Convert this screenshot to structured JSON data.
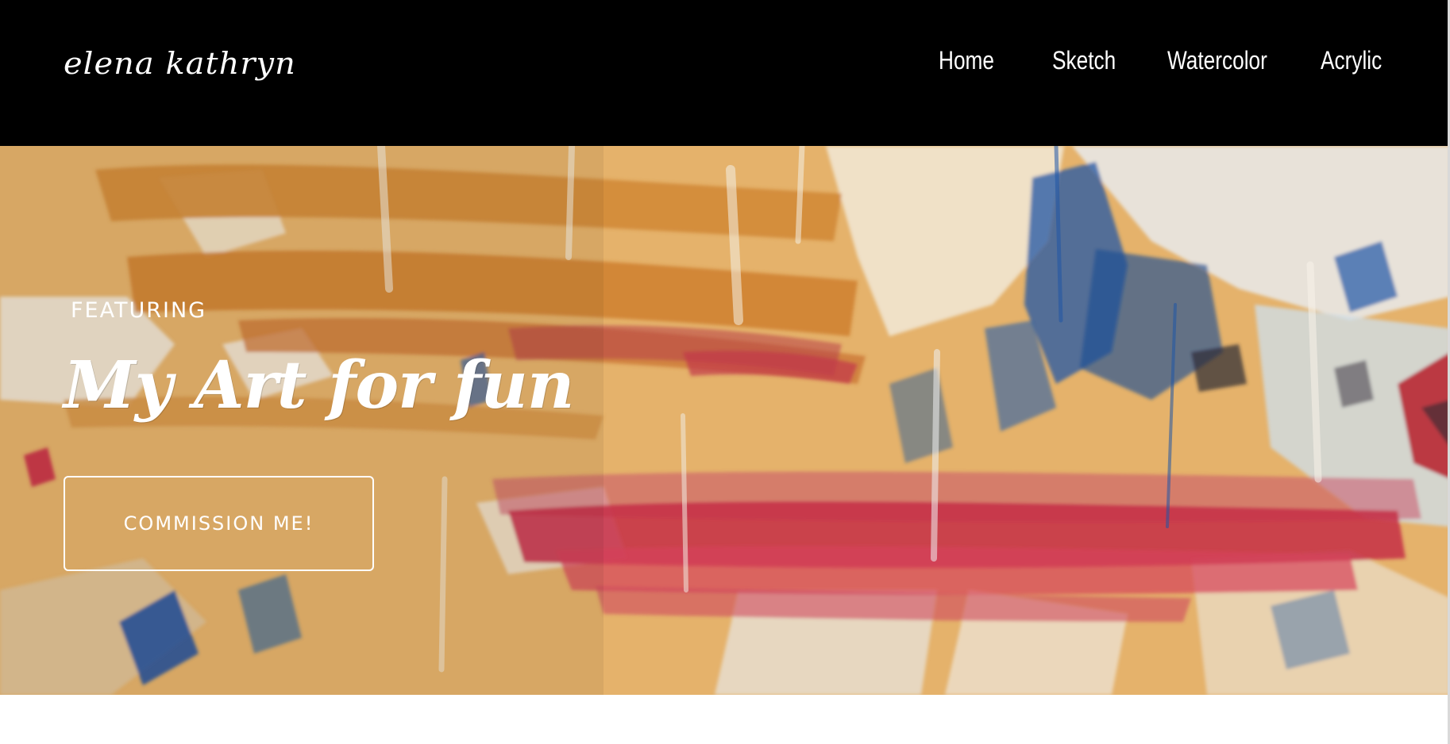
{
  "header": {
    "logo_text": "elena kathryn",
    "nav": [
      {
        "label": "Home"
      },
      {
        "label": "Sketch"
      },
      {
        "label": "Watercolor"
      },
      {
        "label": "Acrylic"
      }
    ]
  },
  "hero": {
    "eyebrow": "FEATURING",
    "title": "My Art for fun",
    "cta_label": "COMMISSION ME!",
    "palette": {
      "base": "#e5b26b",
      "ochre": "#d28a36",
      "cream": "#f1e6d2",
      "pale_blue": "#cfdde6",
      "blue": "#1f56a6",
      "red": "#c62d46",
      "dark": "#2a2a34"
    }
  },
  "colors": {
    "header_bg": "#000000",
    "text": "#ffffff",
    "page_bg": "#ffffff"
  }
}
